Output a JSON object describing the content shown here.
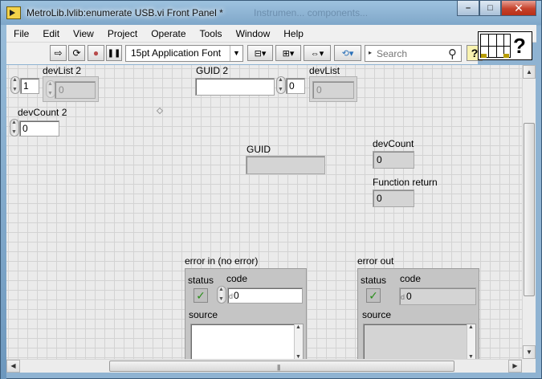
{
  "window": {
    "title": "MetroLib.lvlib:enumerate USB.vi Front Panel *",
    "background_title": "Instrumen... components...",
    "minimize_label": "–",
    "maximize_label": "□",
    "close_label": "✕"
  },
  "menu": [
    "File",
    "Edit",
    "View",
    "Project",
    "Operate",
    "Tools",
    "Window",
    "Help"
  ],
  "toolbar": {
    "run_icon": "⇨",
    "run_continuous_icon": "⟳",
    "abort_icon": "●",
    "pause_icon": "❚❚",
    "font": "15pt Application Font",
    "align_icon": "⊟▾",
    "distribute_icon": "⊞▾",
    "resize_icon": "⇔▾",
    "reorder_icon": "⟲▾",
    "search_placeholder": "Search",
    "help_label": "?"
  },
  "connector_pane": {
    "help_glyph": "?"
  },
  "controls": {
    "devList2": {
      "label": "devList 2",
      "index": "1",
      "element": "0"
    },
    "devCount2": {
      "label": "devCount 2",
      "value": "0"
    },
    "guid2": {
      "label": "GUID 2",
      "value": ""
    },
    "devList": {
      "label": "devList",
      "index": "0",
      "element": "0"
    },
    "guid": {
      "label": "GUID",
      "value": ""
    },
    "devCount": {
      "label": "devCount",
      "value": "0"
    },
    "function_return": {
      "label": "Function return",
      "value": "0"
    },
    "error_in": {
      "label": "error in (no error)",
      "status_label": "status",
      "code_label": "code",
      "code_value": "0",
      "code_prefix": "d",
      "source_label": "source",
      "status_mark": "✓"
    },
    "error_out": {
      "label": "error out",
      "status_label": "status",
      "code_label": "code",
      "code_value": "0",
      "code_prefix": "d",
      "source_label": "source",
      "status_mark": "✓"
    }
  },
  "scrollbar": {
    "grip": "|||"
  }
}
